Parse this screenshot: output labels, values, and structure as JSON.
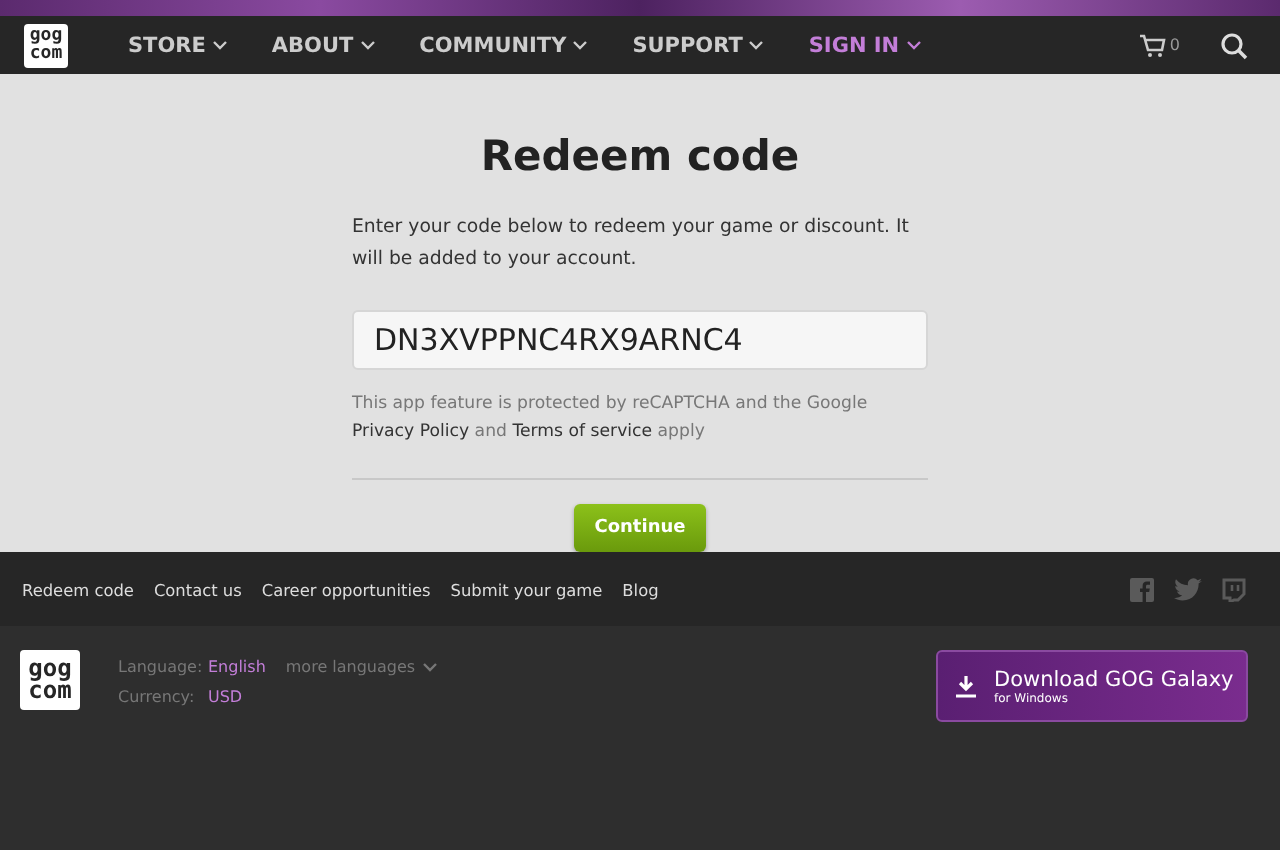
{
  "header": {
    "logo": [
      "gog",
      "com"
    ],
    "nav": [
      {
        "label": "STORE",
        "highlighted": false
      },
      {
        "label": "ABOUT",
        "highlighted": false
      },
      {
        "label": "COMMUNITY",
        "highlighted": false
      },
      {
        "label": "SUPPORT",
        "highlighted": false
      },
      {
        "label": "SIGN IN",
        "highlighted": true
      }
    ],
    "cart_count": "0"
  },
  "redeem": {
    "title": "Redeem code",
    "intro": "Enter your code below to redeem your game or discount. It will be added to your account.",
    "code_field": {
      "value": "DN3XVPPNC4RX9ARNC4"
    },
    "notice": "This app feature is protected by reCAPTCHA and the Google **Privacy Policy** and **Terms of service** apply",
    "button": "Continue"
  },
  "footer": {
    "links": [
      "Redeem code",
      "Contact us",
      "Career opportunities",
      "Submit your game",
      "Blog"
    ],
    "logo": [
      "gog",
      "com"
    ],
    "settings": [
      {
        "label": "Language:",
        "value": "English",
        "extra": "more languages"
      },
      {
        "label": "Currency:",
        "value": "USD"
      }
    ],
    "galaxy_button": {
      "title": "Download GOG Galaxy",
      "subtitle": "for Windows"
    }
  }
}
